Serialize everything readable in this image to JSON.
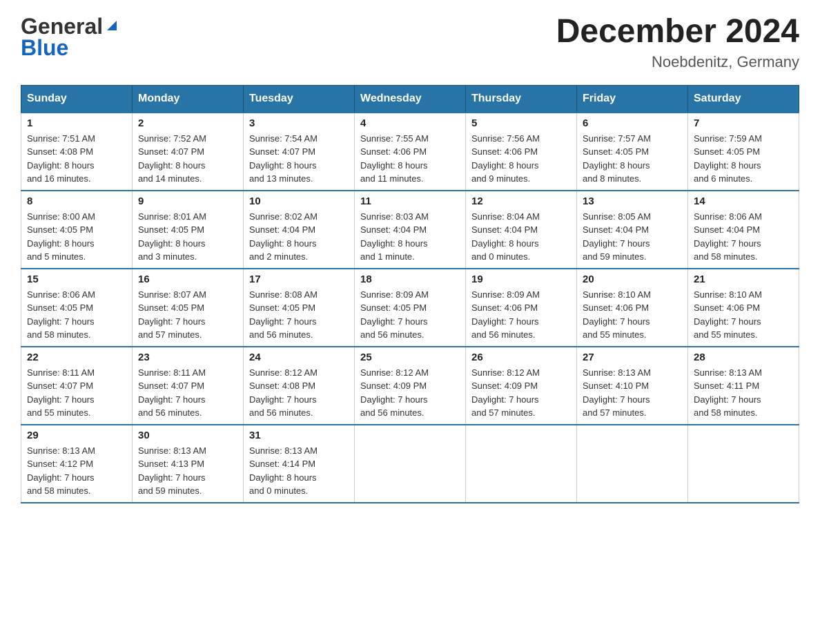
{
  "header": {
    "logo_line1": "General",
    "logo_line2": "Blue",
    "title": "December 2024",
    "subtitle": "Noebdenitz, Germany"
  },
  "days_of_week": [
    "Sunday",
    "Monday",
    "Tuesday",
    "Wednesday",
    "Thursday",
    "Friday",
    "Saturday"
  ],
  "weeks": [
    [
      {
        "day": "1",
        "sunrise": "7:51 AM",
        "sunset": "4:08 PM",
        "daylight": "8 hours and 16 minutes."
      },
      {
        "day": "2",
        "sunrise": "7:52 AM",
        "sunset": "4:07 PM",
        "daylight": "8 hours and 14 minutes."
      },
      {
        "day": "3",
        "sunrise": "7:54 AM",
        "sunset": "4:07 PM",
        "daylight": "8 hours and 13 minutes."
      },
      {
        "day": "4",
        "sunrise": "7:55 AM",
        "sunset": "4:06 PM",
        "daylight": "8 hours and 11 minutes."
      },
      {
        "day": "5",
        "sunrise": "7:56 AM",
        "sunset": "4:06 PM",
        "daylight": "8 hours and 9 minutes."
      },
      {
        "day": "6",
        "sunrise": "7:57 AM",
        "sunset": "4:05 PM",
        "daylight": "8 hours and 8 minutes."
      },
      {
        "day": "7",
        "sunrise": "7:59 AM",
        "sunset": "4:05 PM",
        "daylight": "8 hours and 6 minutes."
      }
    ],
    [
      {
        "day": "8",
        "sunrise": "8:00 AM",
        "sunset": "4:05 PM",
        "daylight": "8 hours and 5 minutes."
      },
      {
        "day": "9",
        "sunrise": "8:01 AM",
        "sunset": "4:05 PM",
        "daylight": "8 hours and 3 minutes."
      },
      {
        "day": "10",
        "sunrise": "8:02 AM",
        "sunset": "4:04 PM",
        "daylight": "8 hours and 2 minutes."
      },
      {
        "day": "11",
        "sunrise": "8:03 AM",
        "sunset": "4:04 PM",
        "daylight": "8 hours and 1 minute."
      },
      {
        "day": "12",
        "sunrise": "8:04 AM",
        "sunset": "4:04 PM",
        "daylight": "8 hours and 0 minutes."
      },
      {
        "day": "13",
        "sunrise": "8:05 AM",
        "sunset": "4:04 PM",
        "daylight": "7 hours and 59 minutes."
      },
      {
        "day": "14",
        "sunrise": "8:06 AM",
        "sunset": "4:04 PM",
        "daylight": "7 hours and 58 minutes."
      }
    ],
    [
      {
        "day": "15",
        "sunrise": "8:06 AM",
        "sunset": "4:05 PM",
        "daylight": "7 hours and 58 minutes."
      },
      {
        "day": "16",
        "sunrise": "8:07 AM",
        "sunset": "4:05 PM",
        "daylight": "7 hours and 57 minutes."
      },
      {
        "day": "17",
        "sunrise": "8:08 AM",
        "sunset": "4:05 PM",
        "daylight": "7 hours and 56 minutes."
      },
      {
        "day": "18",
        "sunrise": "8:09 AM",
        "sunset": "4:05 PM",
        "daylight": "7 hours and 56 minutes."
      },
      {
        "day": "19",
        "sunrise": "8:09 AM",
        "sunset": "4:06 PM",
        "daylight": "7 hours and 56 minutes."
      },
      {
        "day": "20",
        "sunrise": "8:10 AM",
        "sunset": "4:06 PM",
        "daylight": "7 hours and 55 minutes."
      },
      {
        "day": "21",
        "sunrise": "8:10 AM",
        "sunset": "4:06 PM",
        "daylight": "7 hours and 55 minutes."
      }
    ],
    [
      {
        "day": "22",
        "sunrise": "8:11 AM",
        "sunset": "4:07 PM",
        "daylight": "7 hours and 55 minutes."
      },
      {
        "day": "23",
        "sunrise": "8:11 AM",
        "sunset": "4:07 PM",
        "daylight": "7 hours and 56 minutes."
      },
      {
        "day": "24",
        "sunrise": "8:12 AM",
        "sunset": "4:08 PM",
        "daylight": "7 hours and 56 minutes."
      },
      {
        "day": "25",
        "sunrise": "8:12 AM",
        "sunset": "4:09 PM",
        "daylight": "7 hours and 56 minutes."
      },
      {
        "day": "26",
        "sunrise": "8:12 AM",
        "sunset": "4:09 PM",
        "daylight": "7 hours and 57 minutes."
      },
      {
        "day": "27",
        "sunrise": "8:13 AM",
        "sunset": "4:10 PM",
        "daylight": "7 hours and 57 minutes."
      },
      {
        "day": "28",
        "sunrise": "8:13 AM",
        "sunset": "4:11 PM",
        "daylight": "7 hours and 58 minutes."
      }
    ],
    [
      {
        "day": "29",
        "sunrise": "8:13 AM",
        "sunset": "4:12 PM",
        "daylight": "7 hours and 58 minutes."
      },
      {
        "day": "30",
        "sunrise": "8:13 AM",
        "sunset": "4:13 PM",
        "daylight": "7 hours and 59 minutes."
      },
      {
        "day": "31",
        "sunrise": "8:13 AM",
        "sunset": "4:14 PM",
        "daylight": "8 hours and 0 minutes."
      },
      null,
      null,
      null,
      null
    ]
  ],
  "labels": {
    "sunrise": "Sunrise:",
    "sunset": "Sunset:",
    "daylight": "Daylight:"
  }
}
